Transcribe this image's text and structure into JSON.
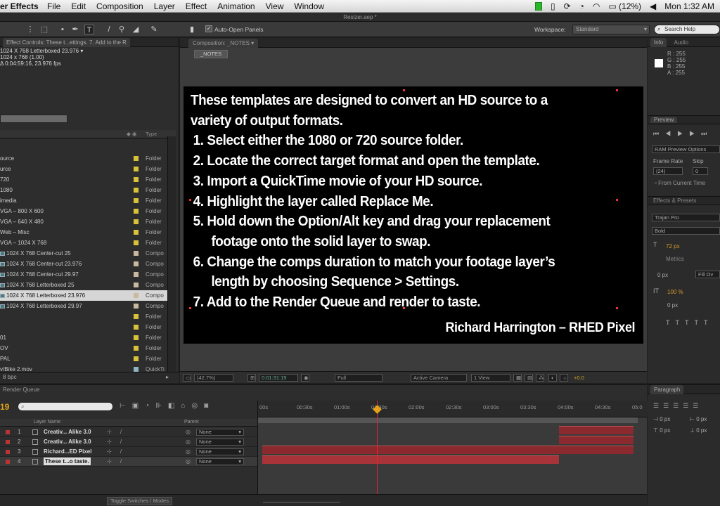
{
  "menubar": {
    "app": "er Effects",
    "menus": [
      "File",
      "Edit",
      "Composition",
      "Layer",
      "Effect",
      "Animation",
      "View",
      "Window"
    ],
    "battery": "(12%)",
    "clock": "Mon 1:32 AM"
  },
  "window_title": "Resizer.aep *",
  "toolbar": {
    "auto_open": "Auto-Open Panels",
    "workspace_label": "Workspace:",
    "workspace_value": "Standard",
    "search_help": "Search Help"
  },
  "project": {
    "effect_controls_tab": "Effect Controls: These t...ettings. 7. Add to the R",
    "comp_title": "1024 X 768 Letterboxed 23.976 ▾",
    "comp_size": "1024 x 768 (1.00)",
    "comp_duration": "Δ 0:04:59:16, 23.976 fps",
    "type_header": "Type",
    "items": [
      {
        "name": "ource",
        "type": "Folder",
        "color": "#d8c23a",
        "comp": false
      },
      {
        "name": "urce",
        "type": "Folder",
        "color": "#d8c23a",
        "comp": false
      },
      {
        "name": "720",
        "type": "Folder",
        "color": "#d8c23a",
        "comp": false
      },
      {
        "name": "1080",
        "type": "Folder",
        "color": "#d8c23a",
        "comp": false
      },
      {
        "name": "imedia",
        "type": "Folder",
        "color": "#d8c23a",
        "comp": false
      },
      {
        "name": "VGA – 800 X 600",
        "type": "Folder",
        "color": "#d8c23a",
        "comp": false
      },
      {
        "name": "VGA – 640 X 480",
        "type": "Folder",
        "color": "#d8c23a",
        "comp": false
      },
      {
        "name": "Web –  Misc",
        "type": "Folder",
        "color": "#d8c23a",
        "comp": false
      },
      {
        "name": "VGA – 1024 X 768",
        "type": "Folder",
        "color": "#d8c23a",
        "comp": false
      },
      {
        "name": "1024 X 768 Center-cut 25",
        "type": "Compo",
        "color": "#c9b9a0",
        "comp": true
      },
      {
        "name": "1024 X 768 Center-cut 23.976",
        "type": "Compo",
        "color": "#c9b9a0",
        "comp": true
      },
      {
        "name": "1024 X 768 Center-cut 29.97",
        "type": "Compo",
        "color": "#c9b9a0",
        "comp": true
      },
      {
        "name": "1024 X 768 Letterboxed 25",
        "type": "Compo",
        "color": "#c9b9a0",
        "comp": true
      },
      {
        "name": "1024 X 768 Letterboxed 23.976",
        "type": "Compo",
        "color": "#c9b9a0",
        "comp": true,
        "selected": true
      },
      {
        "name": "1024 X 768 Letterboxed 29.97",
        "type": "Compo",
        "color": "#c9b9a0",
        "comp": true
      },
      {
        "name": "",
        "type": "Folder",
        "color": "#d8c23a",
        "comp": false
      },
      {
        "name": "",
        "type": "Folder",
        "color": "#d8c23a",
        "comp": false
      },
      {
        "name": "01",
        "type": "Folder",
        "color": "#d8c23a",
        "comp": false
      },
      {
        "name": "OV",
        "type": "Folder",
        "color": "#d8c23a",
        "comp": false
      },
      {
        "name": "PAL",
        "type": "Folder",
        "color": "#d8c23a",
        "comp": false
      },
      {
        "name": "v/Bike 2.mov",
        "type": "QuickTi",
        "color": "#8fb3c0",
        "comp": false
      },
      {
        "name": "",
        "type": "Folder",
        "color": "#d8c23a",
        "comp": false
      }
    ],
    "bpc": "8 bpc"
  },
  "composition": {
    "tab_label": "Composition: _NOTES",
    "notes_button": "_NOTES",
    "intro": [
      "These templates are designed to convert an HD source to a",
      "variety of output formats."
    ],
    "steps": [
      [
        "1. Select either the 1080 or 720 source folder."
      ],
      [
        "2. Locate the correct target format and open the template."
      ],
      [
        "3. Import a QuickTime movie of your HD source."
      ],
      [
        "4. Highlight the layer called Replace Me."
      ],
      [
        "5. Hold down the Option/Alt key and drag your replacement",
        "footage onto the solid layer to swap."
      ],
      [
        "6. Change the comps duration to match your footage layer’s",
        "length by choosing Sequence > Settings."
      ],
      [
        "7. Add to the Render Queue and render to taste."
      ]
    ],
    "credit": "Richard Harrington – RHED Pixel",
    "zoom": "(42.7%)",
    "timecode": "0:01:31:19",
    "resolution": "Full",
    "camera": "Active Camera",
    "views": "1 View",
    "offset": "+0.0"
  },
  "right": {
    "info_tab": "Info",
    "audio_tab": "Audio",
    "rgba": [
      "R : 255",
      "G : 255",
      "B : 255",
      "A : 255"
    ],
    "preview_tab": "Preview",
    "ram_preview": "RAM Preview Options",
    "frame_rate_label": "Frame Rate",
    "skip_label": "Skip",
    "frame_rate": "(24)",
    "skip": "0",
    "from_current": "From Current Time",
    "effects_tab": "Effects & Presets",
    "font": "Trajan Pro",
    "style": "Bold",
    "size": "72 px",
    "metrics": "Metrics",
    "tracking_px": "0 px",
    "fill": "Fill Ov",
    "vscale": "100 %",
    "baseline": "0 px",
    "paragraph_tab": "Paragraph",
    "para_vals": [
      "0 px",
      "0 px",
      "0 px",
      "0 px"
    ]
  },
  "timeline": {
    "tab": "Render Queue",
    "current_time": "19",
    "layer_name_header": "Layer Name",
    "parent_header": "Parent",
    "ticks": [
      "00s",
      "00:30s",
      "01:00s",
      "01:30s",
      "02:00s",
      "02:30s",
      "03:00s",
      "03:30s",
      "04:00s",
      "04:30s",
      "05:0"
    ],
    "layers": [
      {
        "num": "1",
        "name": "Creativ... Alike 3.0",
        "parent": "None",
        "color": "#b33"
      },
      {
        "num": "2",
        "name": "Creativ... Alike 3.0",
        "parent": "None",
        "color": "#b33"
      },
      {
        "num": "3",
        "name": "Richard...ED Pixel",
        "parent": "None",
        "color": "#b33"
      },
      {
        "num": "4",
        "name": "These t...o taste.",
        "parent": "None",
        "color": "#b33"
      }
    ],
    "toggle": "Toggle Switches / Modes"
  }
}
